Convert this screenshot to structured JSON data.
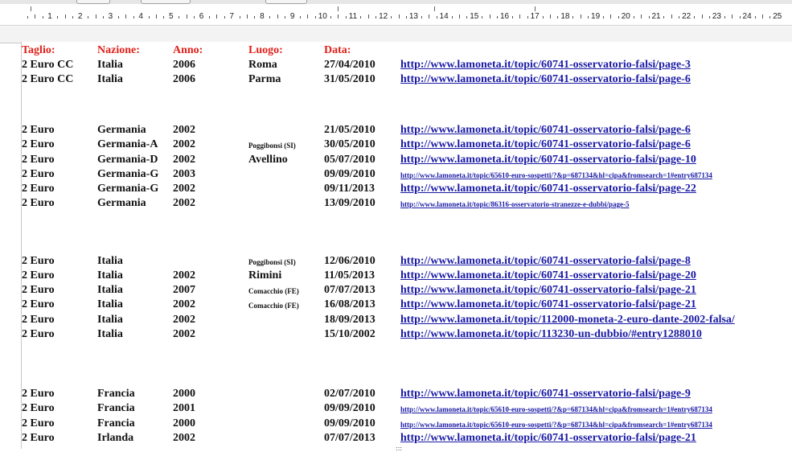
{
  "header": {
    "taglio": "Taglio:",
    "nazione": "Nazione:",
    "anno": "Anno:",
    "luogo": "Luogo:",
    "data": "Data:"
  },
  "ruler": {
    "numbers": [
      "1",
      "2",
      "3",
      "4",
      "5",
      "6",
      "7",
      "8",
      "9",
      "10",
      "11",
      "12",
      "13",
      "14",
      "15",
      "16",
      "17",
      "18",
      "19",
      "20",
      "21",
      "22",
      "23",
      "24",
      "25"
    ]
  },
  "rows": [
    {
      "taglio": "2 Euro CC",
      "nazione": "Italia",
      "anno": "2006",
      "luogo": "Roma",
      "data": "27/04/2010",
      "link": "http://www.lamoneta.it/topic/60741-osservatorio-falsi/page-3"
    },
    {
      "taglio": "2 Euro CC",
      "nazione": "Italia",
      "anno": "2006",
      "luogo": "Parma",
      "data": "31/05/2010",
      "link": "http://www.lamoneta.it/topic/60741-osservatorio-falsi/page-6"
    },
    {
      "taglio": "2 Euro",
      "nazione": "Germania",
      "anno": "2002",
      "luogo": "",
      "data": "21/05/2010",
      "link": "http://www.lamoneta.it/topic/60741-osservatorio-falsi/page-6"
    },
    {
      "taglio": "2 Euro",
      "nazione": "Germania-A",
      "anno": "2002",
      "luogo": "Poggibonsi (SI)",
      "data": "30/05/2010",
      "link": "http://www.lamoneta.it/topic/60741-osservatorio-falsi/page-6"
    },
    {
      "taglio": "2 Euro",
      "nazione": "Germania-D",
      "anno": "2002",
      "luogo": "Avellino",
      "data": "05/07/2010",
      "link": "http://www.lamoneta.it/topic/60741-osservatorio-falsi/page-10"
    },
    {
      "taglio": "2 Euro",
      "nazione": "Germania-G",
      "anno": "2003",
      "luogo": "",
      "data": "09/09/2010",
      "link": "http://www.lamoneta.it/topic/65610-euro-sospetti/?&p=687134&hl=cipa&fromsearch=1#entry687134"
    },
    {
      "taglio": "2 Euro",
      "nazione": "Germania-G",
      "anno": "2002",
      "luogo": "",
      "data": "09/11/2013",
      "link": "http://www.lamoneta.it/topic/60741-osservatorio-falsi/page-22"
    },
    {
      "taglio": "2 Euro",
      "nazione": "Germania",
      "anno": "2002",
      "luogo": "",
      "data": "13/09/2010",
      "link": "http://www.lamoneta.it/topic/86316-osservatorio-stranezze-e-dubbi/page-5"
    },
    {
      "taglio": "2 Euro",
      "nazione": "Italia",
      "anno": "",
      "luogo": "Poggibonsi (SI)",
      "data": "12/06/2010",
      "link": "http://www.lamoneta.it/topic/60741-osservatorio-falsi/page-8"
    },
    {
      "taglio": "2 Euro",
      "nazione": "Italia",
      "anno": "2002",
      "luogo": "Rimini",
      "data": "11/05/2013",
      "link": "http://www.lamoneta.it/topic/60741-osservatorio-falsi/page-20"
    },
    {
      "taglio": "2 Euro",
      "nazione": "Italia",
      "anno": "2007",
      "luogo": "Comacchio (FE)",
      "data": "07/07/2013",
      "link": "http://www.lamoneta.it/topic/60741-osservatorio-falsi/page-21"
    },
    {
      "taglio": "2 Euro",
      "nazione": "Italia",
      "anno": "2002",
      "luogo": "Comacchio (FE)",
      "data": "16/08/2013",
      "link": "http://www.lamoneta.it/topic/60741-osservatorio-falsi/page-21"
    },
    {
      "taglio": "2 Euro",
      "nazione": "Italia",
      "anno": "2002",
      "luogo": "",
      "data": "18/09/2013",
      "link": "http://www.lamoneta.it/topic/112000-moneta-2-euro-dante-2002-falsa/"
    },
    {
      "taglio": "2 Euro",
      "nazione": "Italia",
      "anno": "2002",
      "luogo": "",
      "data": "15/10/2002",
      "link": "http://www.lamoneta.it/topic/113230-un-dubbio/#entry1288010"
    },
    {
      "taglio": "2 Euro",
      "nazione": "Francia",
      "anno": "2000",
      "luogo": "",
      "data": "02/07/2010",
      "link": "http://www.lamoneta.it/topic/60741-osservatorio-falsi/page-9"
    },
    {
      "taglio": "2 Euro",
      "nazione": "Francia",
      "anno": "2001",
      "luogo": "",
      "data": "09/09/2010",
      "link": "http://www.lamoneta.it/topic/65610-euro-sospetti/?&p=687134&hl=cipa&fromsearch=1#entry687134"
    },
    {
      "taglio": "2 Euro",
      "nazione": "Francia",
      "anno": "2000",
      "luogo": "",
      "data": "09/09/2010",
      "link": "http://www.lamoneta.it/topic/65610-euro-sospetti/?&p=687134&hl=cipa&fromsearch=1#entry687134"
    },
    {
      "taglio": "2 Euro",
      "nazione": "Irlanda",
      "anno": "2002",
      "luogo": "",
      "data": "07/07/2013",
      "link": "http://www.lamoneta.it/topic/60741-osservatorio-falsi/page-21"
    }
  ]
}
